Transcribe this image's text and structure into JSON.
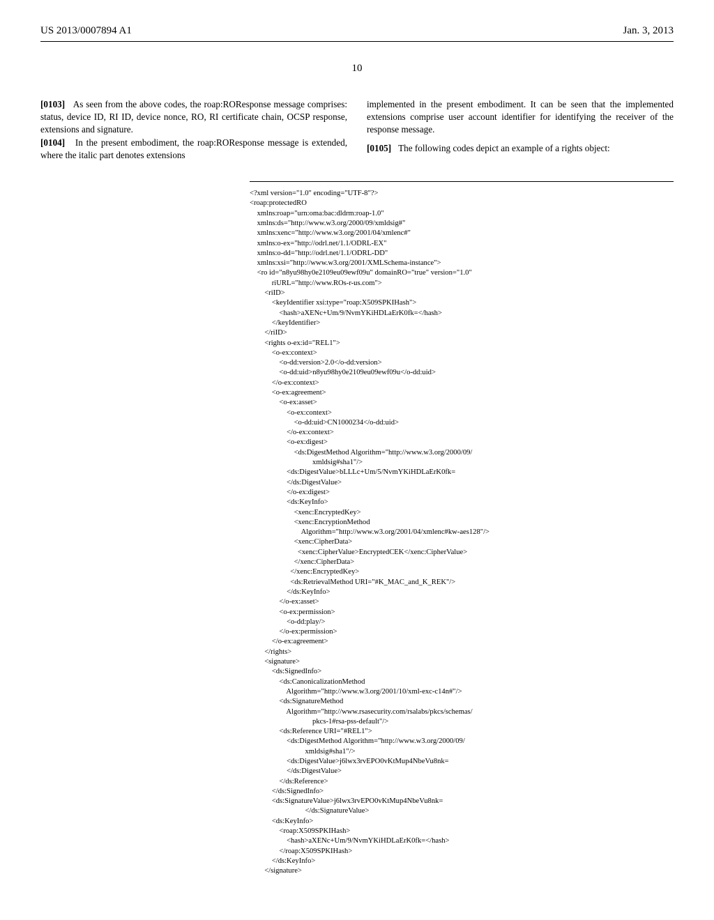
{
  "header": {
    "pubnum": "US 2013/0007894 A1",
    "date": "Jan. 3, 2013"
  },
  "pagenum": "10",
  "left": {
    "p103_num": "[0103]",
    "p103": "As seen from the above codes, the roap:ROResponse message comprises: status, device ID, RI ID, device nonce, RO, RI certificate chain, OCSP response, extensions and signature.",
    "p104_num": "[0104]",
    "p104": "In the present embodiment, the roap:ROResponse message is extended, where the italic part denotes extensions"
  },
  "right": {
    "p104b": "implemented in the present embodiment. It can be seen that the implemented extensions comprise user account identifier for identifying the receiver of the response message.",
    "p105_num": "[0105]",
    "p105": "The following codes depict an example of a rights object:"
  },
  "code": "<?xml version=\"1.0\" encoding=\"UTF-8\"?>\n<roap:protectedRO\n    xmlns:roap=\"urn:oma:bac:dldrm:roap-1.0\"\n    xmlns:ds=\"http://www.w3.org/2000/09/xmldsig#\"\n    xmlns:xenc=\"http://www.w3.org/2001/04/xmlenc#\"\n    xmlns:o-ex=\"http://odrl.net/1.1/ODRL-EX\"\n    xmlns:o-dd=\"http://odrl.net/1.1/ODRL-DD\"\n    xmlns:xsi=\"http://www.w3.org/2001/XMLSchema-instance\">\n    <ro id=\"n8yu98hy0e2109eu09ewf09u\" domainRO=\"true\" version=\"1.0\"\n            riURL=\"http://www.ROs-r-us.com\">\n        <riID>\n            <keyIdentifier xsi:type=\"roap:X509SPKIHash\">\n                <hash>aXENc+Um/9/NvmYKiHDLaErK0fk=</hash>\n            </keyIdentifier>\n        </riID>\n        <rights o-ex:id=\"REL1\">\n            <o-ex:context>\n                <o-dd:version>2.0</o-dd:version>\n                <o-dd:uid>n8yu98hy0e2109eu09ewf09u</o-dd:uid>\n            </o-ex:context>\n            <o-ex:agreement>\n                <o-ex:asset>\n                    <o-ex:context>\n                        <o-dd:uid>CN1000234</o-dd:uid>\n                    </o-ex:context>\n                    <o-ex:digest>\n                        <ds:DigestMethod Algorithm=\"http://www.w3.org/2000/09/\n                                  xmldsig#sha1\"/>\n                    <ds:DigestValue>bLLLc+Um/5/NvmYKiHDLaErK0fk=\n                    </ds:DigestValue>\n                    </o-ex:digest>\n                    <ds:KeyInfo>\n                        <xenc:EncryptedKey>\n                        <xenc:EncryptionMethod\n                            Algorithm=\"http://www.w3.org/2001/04/xmlenc#kw-aes128\"/>\n                        <xenc:CipherData>\n                          <xenc:CipherValue>EncryptedCEK</xenc:CipherValue>\n                        </xenc:CipherData>\n                      </xenc:EncryptedKey>\n                      <ds:RetrievalMethod URI=\"#K_MAC_and_K_REK\"/>\n                    </ds:KeyInfo>\n                </o-ex:asset>\n                <o-ex:permission>\n                    <o-dd:play/>\n                </o-ex:permission>\n            </o-ex:agreement>\n        </rights>\n        <signature>\n            <ds:SignedInfo>\n                <ds:CanonicalizationMethod\n                    Algorithm=\"http://www.w3.org/2001/10/xml-exc-c14n#\"/>\n                <ds:SignatureMethod\n                    Algorithm=\"http://www.rsasecurity.com/rsalabs/pkcs/schemas/\n                                  pkcs-1#rsa-pss-default\"/>\n                <ds:Reference URI=\"#REL1\">\n                    <ds:DigestMethod Algorithm=\"http://www.w3.org/2000/09/\n                              xmldsig#sha1\"/>\n                    <ds:DigestValue>j6lwx3rvEPO0vKtMup4NbeVu8nk=\n                    </ds:DigestValue>\n                </ds:Reference>\n            </ds:SignedInfo>\n            <ds:SignatureValue>j6lwx3rvEPO0vKtMup4NbeVu8nk=\n                              </ds:SignatureValue>\n            <ds:KeyInfo>\n                <roap:X509SPKIHash>\n                    <hash>aXENc+Um/9/NvmYKiHDLaErK0fk=</hash>\n                </roap:X509SPKIHash>\n            </ds:KeyInfo>\n        </signature>"
}
